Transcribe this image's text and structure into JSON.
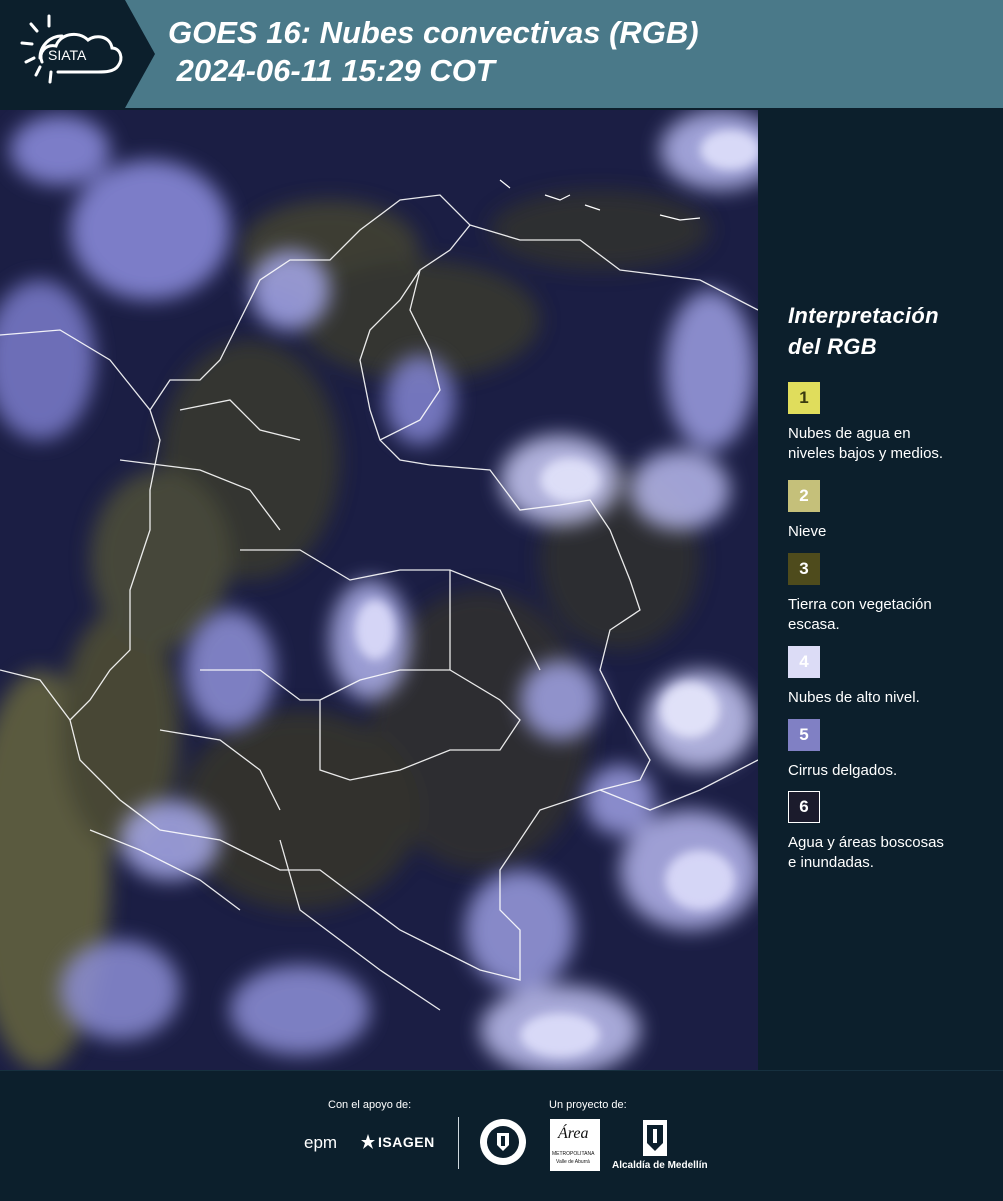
{
  "header": {
    "logo_text": "SIATA",
    "title_line1": "GOES 16: Nubes convectivas (RGB)",
    "title_line2": " 2024-06-11 15:29 COT"
  },
  "legend": {
    "title_line1": "Interpretación",
    "title_line2": "del RGB",
    "items": [
      {
        "number": "1",
        "label_line1": "Nubes de agua en",
        "label_line2": "niveles bajos y medios.",
        "color": "#e0dd5c",
        "text_color": "#3a3a10"
      },
      {
        "number": "2",
        "label_line1": "Nieve",
        "label_line2": "",
        "color": "#c5c07a",
        "text_color": "#ffffff"
      },
      {
        "number": "3",
        "label_line1": "Tierra con vegetación",
        "label_line2": "escasa.",
        "color": "#4e4b1c",
        "text_color": "#ffffff"
      },
      {
        "number": "4",
        "label_line1": "Nubes de alto nivel.",
        "label_line2": "",
        "color": "#dcdcf6",
        "text_color": "#ffffff"
      },
      {
        "number": "5",
        "label_line1": "Cirrus delgados.",
        "label_line2": "",
        "color": "#8080c4",
        "text_color": "#ffffff"
      },
      {
        "number": "6",
        "label_line1": "Agua y áreas boscosas",
        "label_line2": "e inundadas.",
        "color": "#1b1b2c",
        "text_color": "#ffffff"
      }
    ]
  },
  "footer": {
    "support_caption": "Con el apoyo de:",
    "project_caption": "Un proyecto de:",
    "sponsor_epm": "epm",
    "sponsor_isagen": "ISAGEN",
    "sponsor_area": "Área",
    "sponsor_area_sub1": "METROPOLITANA",
    "sponsor_area_sub2": "Valle de Aburrá",
    "sponsor_alcaldia": "Alcaldía de Medellín"
  }
}
